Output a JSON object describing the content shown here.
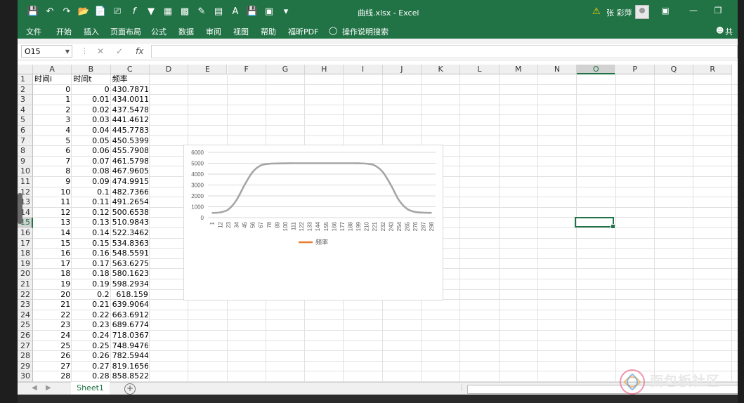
{
  "window": {
    "title": "曲线.xlsx  -  Excel",
    "user": "张 彩萍",
    "accent": "#217346"
  },
  "ribbon": {
    "tabs": [
      "文件",
      "开始",
      "插入",
      "页面布局",
      "公式",
      "数据",
      "审阅",
      "视图",
      "帮助",
      "福昕PDF"
    ],
    "tell_me": "操作说明搜索",
    "share": "共享"
  },
  "formula_bar": {
    "name_box": "O15",
    "value": ""
  },
  "columns": [
    "A",
    "B",
    "C",
    "D",
    "E",
    "F",
    "G",
    "H",
    "I",
    "J",
    "K",
    "L",
    "M",
    "N",
    "O",
    "P",
    "Q",
    "R"
  ],
  "rows": [
    {
      "n": "1",
      "a": "时间i",
      "b": "时间t",
      "c": "频率"
    },
    {
      "n": "2",
      "a": "0",
      "b": "0",
      "c": "430.7871"
    },
    {
      "n": "3",
      "a": "1",
      "b": "0.01",
      "c": "434.0011"
    },
    {
      "n": "4",
      "a": "2",
      "b": "0.02",
      "c": "437.5478"
    },
    {
      "n": "5",
      "a": "3",
      "b": "0.03",
      "c": "441.4612"
    },
    {
      "n": "6",
      "a": "4",
      "b": "0.04",
      "c": "445.7783"
    },
    {
      "n": "7",
      "a": "5",
      "b": "0.05",
      "c": "450.5399"
    },
    {
      "n": "8",
      "a": "6",
      "b": "0.06",
      "c": "455.7908"
    },
    {
      "n": "9",
      "a": "7",
      "b": "0.07",
      "c": "461.5798"
    },
    {
      "n": "10",
      "a": "8",
      "b": "0.08",
      "c": "467.9605"
    },
    {
      "n": "11",
      "a": "9",
      "b": "0.09",
      "c": "474.9915"
    },
    {
      "n": "12",
      "a": "10",
      "b": "0.1",
      "c": "482.7366"
    },
    {
      "n": "13",
      "a": "11",
      "b": "0.11",
      "c": "491.2654"
    },
    {
      "n": "14",
      "a": "12",
      "b": "0.12",
      "c": "500.6538"
    },
    {
      "n": "15",
      "a": "13",
      "b": "0.13",
      "c": "510.9843"
    },
    {
      "n": "16",
      "a": "14",
      "b": "0.14",
      "c": "522.3462"
    },
    {
      "n": "17",
      "a": "15",
      "b": "0.15",
      "c": "534.8363"
    },
    {
      "n": "18",
      "a": "16",
      "b": "0.16",
      "c": "548.5591"
    },
    {
      "n": "19",
      "a": "17",
      "b": "0.17",
      "c": "563.6275"
    },
    {
      "n": "20",
      "a": "18",
      "b": "0.18",
      "c": "580.1623"
    },
    {
      "n": "21",
      "a": "19",
      "b": "0.19",
      "c": "598.2934"
    },
    {
      "n": "22",
      "a": "20",
      "b": "0.2",
      "c": "618.159"
    },
    {
      "n": "23",
      "a": "21",
      "b": "0.21",
      "c": "639.9064"
    },
    {
      "n": "24",
      "a": "22",
      "b": "0.22",
      "c": "663.6912"
    },
    {
      "n": "25",
      "a": "23",
      "b": "0.23",
      "c": "689.6774"
    },
    {
      "n": "26",
      "a": "24",
      "b": "0.24",
      "c": "718.0367"
    },
    {
      "n": "27",
      "a": "25",
      "b": "0.25",
      "c": "748.9476"
    },
    {
      "n": "28",
      "a": "26",
      "b": "0.26",
      "c": "782.5944"
    },
    {
      "n": "29",
      "a": "27",
      "b": "0.27",
      "c": "819.1656"
    },
    {
      "n": "30",
      "a": "28",
      "b": "0.28",
      "c": "858.8522"
    }
  ],
  "sheet_tab": "Sheet1",
  "watermark": "面包板社区",
  "chart_data": {
    "type": "line",
    "categories": [
      "1",
      "12",
      "23",
      "34",
      "45",
      "56",
      "67",
      "78",
      "89",
      "100",
      "111",
      "122",
      "133",
      "144",
      "155",
      "166",
      "177",
      "188",
      "199",
      "210",
      "221",
      "232",
      "243",
      "254",
      "265",
      "276",
      "287",
      "298"
    ],
    "series": [
      {
        "name": "频率",
        "color": "#ed7d31",
        "line_color": "#a5a5a5",
        "values": [
          431,
          482,
          750,
          1600,
          3000,
          4200,
          4800,
          4950,
          4980,
          4990,
          5000,
          5000,
          5000,
          5000,
          5000,
          5000,
          5000,
          5000,
          4995,
          4960,
          4800,
          4200,
          3000,
          1600,
          800,
          520,
          460,
          440
        ]
      }
    ],
    "ylim": [
      0,
      6000
    ],
    "yticks": [
      "0",
      "1000",
      "2000",
      "3000",
      "4000",
      "5000",
      "6000"
    ],
    "grid": true,
    "legend": "bottom"
  }
}
